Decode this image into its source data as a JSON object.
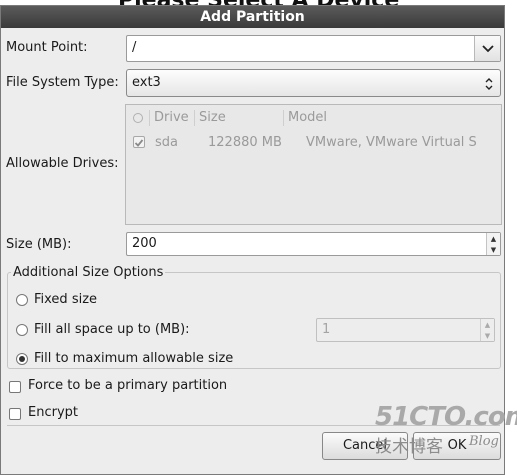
{
  "background": {
    "heading": "Please Select A Device"
  },
  "dialog": {
    "title": "Add Partition",
    "mount_point": {
      "label": "Mount Point:",
      "value": "/"
    },
    "fs_type": {
      "label": "File System Type:",
      "value": "ext3"
    },
    "drives": {
      "label": "Allowable Drives:",
      "columns": [
        "Drive",
        "Size",
        "Model"
      ],
      "rows": [
        {
          "drive": "sda",
          "size": "122880 MB",
          "model": "VMware, VMware Virtual S",
          "checked": true
        }
      ]
    },
    "size": {
      "label": "Size (MB):",
      "value": "200"
    },
    "size_options": {
      "legend": "Additional Size Options",
      "fixed": "Fixed size",
      "fill_up_to": "Fill all space up to (MB):",
      "fill_up_to_value": "1",
      "fill_max": "Fill to maximum allowable size",
      "selected": "fill_max"
    },
    "primary": {
      "label": "Force to be a primary partition",
      "checked": false
    },
    "encrypt": {
      "label": "Encrypt",
      "checked": false
    },
    "buttons": {
      "cancel": "Cancel",
      "ok": "OK"
    }
  },
  "watermark": {
    "brand": "51CTO.com",
    "sub": "技术博客",
    "blog": "Blog"
  }
}
